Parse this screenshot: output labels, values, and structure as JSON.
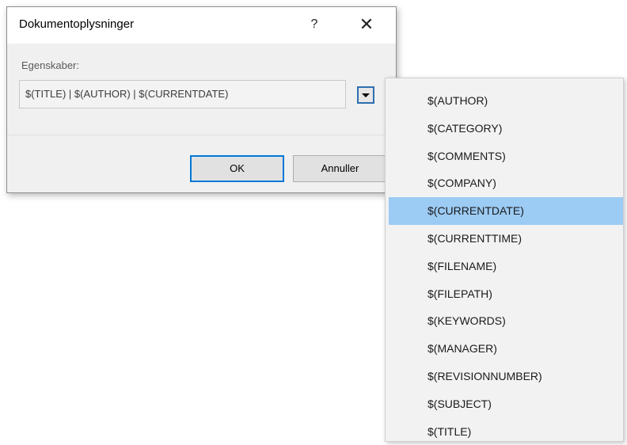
{
  "dialog": {
    "title": "Dokumentoplysninger",
    "help_label": "?",
    "close_label": "✕",
    "field_label": "Egenskaber:",
    "field_value": "$(TITLE) | $(AUTHOR) | $(CURRENTDATE)",
    "ok_label": "OK",
    "cancel_label": "Annuller"
  },
  "dropdown": {
    "items": [
      {
        "label": "$(AUTHOR)"
      },
      {
        "label": "$(CATEGORY)"
      },
      {
        "label": "$(COMMENTS)"
      },
      {
        "label": "$(COMPANY)"
      },
      {
        "label": "$(CURRENTDATE)"
      },
      {
        "label": "$(CURRENTTIME)"
      },
      {
        "label": "$(FILENAME)"
      },
      {
        "label": "$(FILEPATH)"
      },
      {
        "label": "$(KEYWORDS)"
      },
      {
        "label": "$(MANAGER)"
      },
      {
        "label": "$(REVISIONNUMBER)"
      },
      {
        "label": "$(SUBJECT)"
      },
      {
        "label": "$(TITLE)"
      }
    ],
    "selected_label": "$(CURRENTDATE)",
    "highlight_color": "#9ccbf4"
  }
}
